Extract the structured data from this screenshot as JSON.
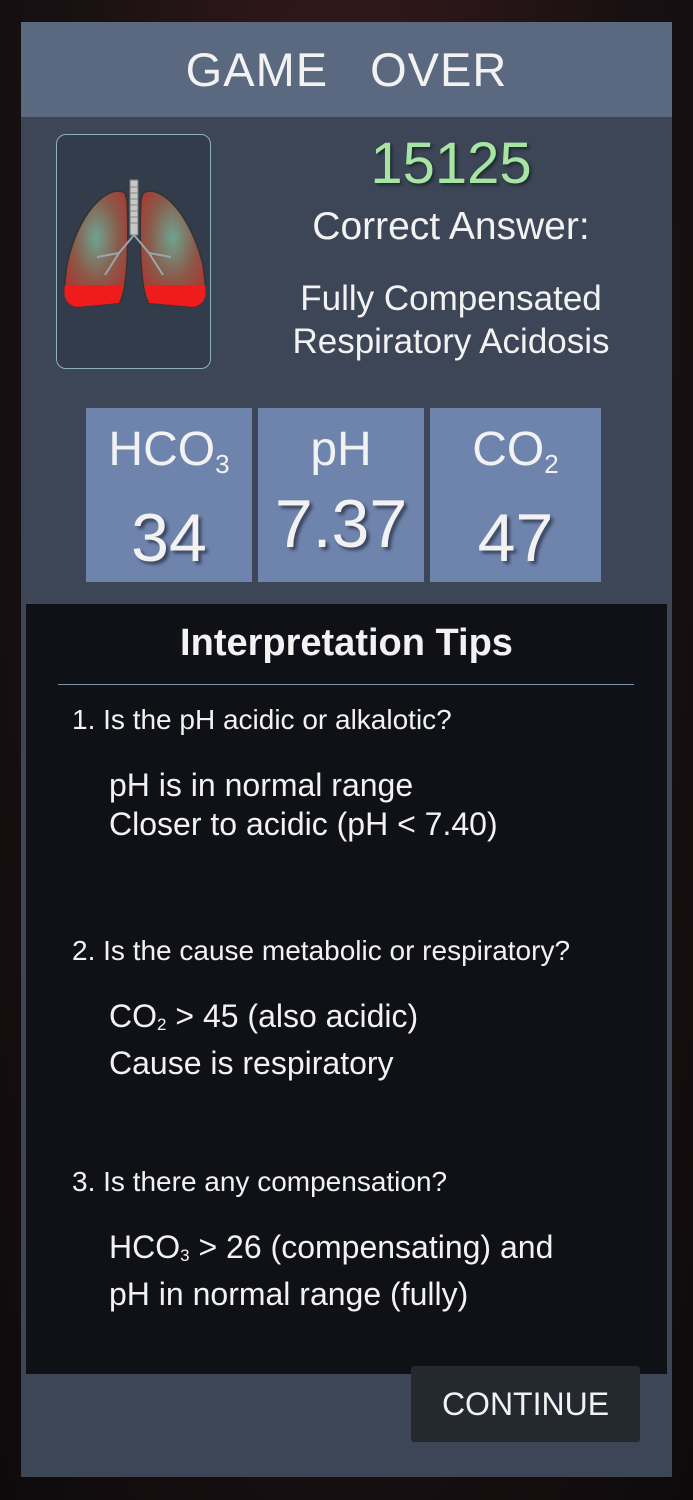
{
  "header": {
    "title": "GAME OVER"
  },
  "result": {
    "score": "15125",
    "answer_label": "Correct Answer:",
    "answer_line1": "Fully Compensated",
    "answer_line2": "Respiratory Acidosis"
  },
  "values": {
    "hco3": {
      "label": "HCO",
      "sub": "3",
      "value": "34"
    },
    "ph": {
      "label": "pH",
      "value": "7.37"
    },
    "co2": {
      "label": "CO",
      "sub": "2",
      "value": "47"
    }
  },
  "tips": {
    "title": "Interpretation Tips",
    "items": [
      {
        "question": "1. Is the pH acidic or alkalotic?",
        "line1": "pH is in normal range",
        "line2": "Closer to acidic (pH < 7.40)"
      },
      {
        "question": "2. Is the cause metabolic or respiratory?",
        "line1_prefix": "CO",
        "line1_sub": "2",
        "line1_rest": " > 45 (also acidic)",
        "line2": "Cause is respiratory"
      },
      {
        "question": "3. Is there any compensation?",
        "line1_prefix": "HCO",
        "line1_sub": "3",
        "line1_rest": " > 26 (compensating) and",
        "line2": "pH in normal range (fully)"
      }
    ]
  },
  "buttons": {
    "continue": "CONTINUE"
  },
  "colors": {
    "score": "#a6e6a2",
    "header_bg": "#5a6880",
    "panel_bg": "#3c4656",
    "tile_bg": "#6f84ad",
    "tips_bg": "#101116"
  },
  "icons": {
    "lung": "lungs-icon"
  }
}
